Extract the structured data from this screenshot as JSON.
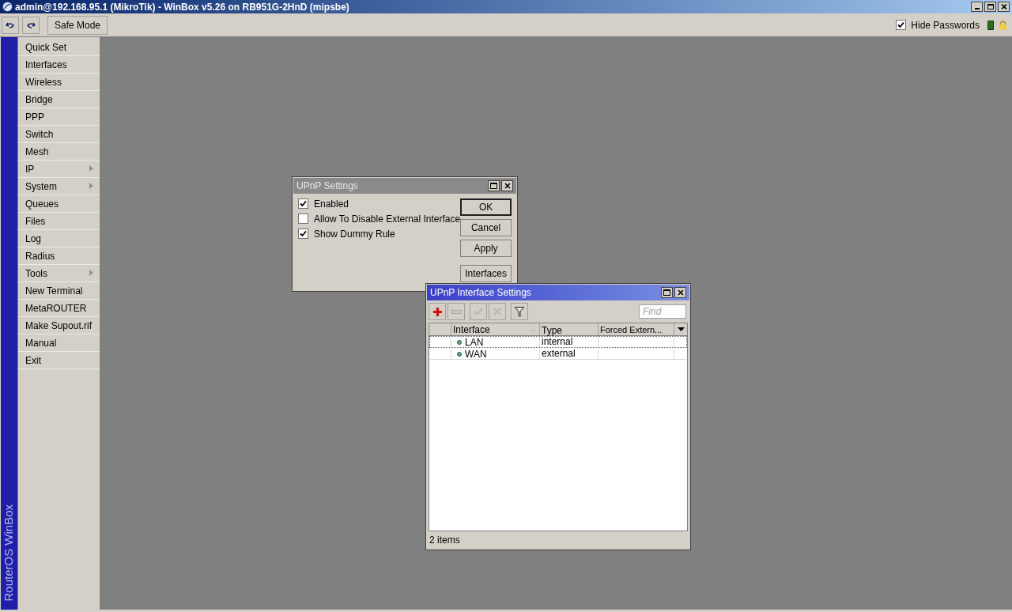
{
  "window": {
    "title": "admin@192.168.95.1 (MikroTik) - WinBox v5.26 on RB951G-2HnD (mipsbe)"
  },
  "toolbar": {
    "safe_mode": "Safe Mode",
    "hide_passwords": {
      "label": "Hide Passwords",
      "checked": true
    }
  },
  "sidebar": {
    "brand": "RouterOS WinBox",
    "items": [
      {
        "label": "Quick Set",
        "submenu": false
      },
      {
        "label": "Interfaces",
        "submenu": false
      },
      {
        "label": "Wireless",
        "submenu": false
      },
      {
        "label": "Bridge",
        "submenu": false
      },
      {
        "label": "PPP",
        "submenu": false
      },
      {
        "label": "Switch",
        "submenu": false
      },
      {
        "label": "Mesh",
        "submenu": false
      },
      {
        "label": "IP",
        "submenu": true
      },
      {
        "label": "System",
        "submenu": true
      },
      {
        "label": "Queues",
        "submenu": false
      },
      {
        "label": "Files",
        "submenu": false
      },
      {
        "label": "Log",
        "submenu": false
      },
      {
        "label": "Radius",
        "submenu": false
      },
      {
        "label": "Tools",
        "submenu": true
      },
      {
        "label": "New Terminal",
        "submenu": false
      },
      {
        "label": "MetaROUTER",
        "submenu": false
      },
      {
        "label": "Make Supout.rif",
        "submenu": false
      },
      {
        "label": "Manual",
        "submenu": false
      },
      {
        "label": "Exit",
        "submenu": false
      }
    ]
  },
  "upnp_settings": {
    "title": "UPnP Settings",
    "active": false,
    "options": [
      {
        "label": "Enabled",
        "checked": true
      },
      {
        "label": "Allow To Disable External Interface",
        "checked": false
      },
      {
        "label": "Show Dummy Rule",
        "checked": true
      }
    ],
    "buttons": [
      "OK",
      "Cancel",
      "Apply",
      "Interfaces"
    ]
  },
  "interface_settings": {
    "title": "UPnP Interface Settings",
    "active": true,
    "find": {
      "placeholder": "Find"
    },
    "table": {
      "columns": [
        "Interface",
        "Type",
        "Forced Extern..."
      ],
      "rows": [
        {
          "interface": "LAN",
          "type": "internal",
          "selected": true
        },
        {
          "interface": "WAN",
          "type": "external",
          "selected": false
        }
      ]
    },
    "status": "2 items"
  }
}
